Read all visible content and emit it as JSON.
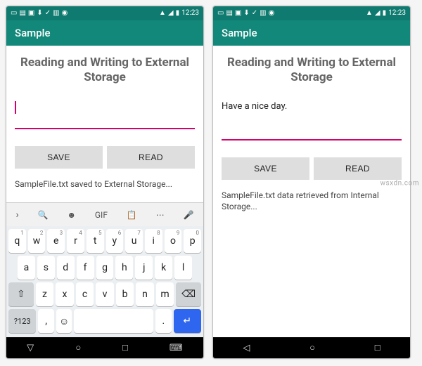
{
  "watermark": "wsxdn.com",
  "statusbar": {
    "time": "12:23"
  },
  "appbar": {
    "title": "Sample"
  },
  "screen": {
    "heading": "Reading and Writing to External Storage",
    "save_label": "SAVE",
    "read_label": "READ"
  },
  "left": {
    "input_value": "",
    "status_text": "SampleFile.txt saved to External Storage..."
  },
  "right": {
    "input_value": "Have a nice day.",
    "status_text": "SampleFile.txt data retrieved from Internal Storage..."
  },
  "keyboard": {
    "suggest": {
      "gif": "GIF"
    },
    "row1": [
      "q",
      "w",
      "e",
      "r",
      "t",
      "y",
      "u",
      "i",
      "o",
      "p"
    ],
    "nums1": [
      "1",
      "2",
      "3",
      "4",
      "5",
      "6",
      "7",
      "8",
      "9",
      "0"
    ],
    "row2": [
      "a",
      "s",
      "d",
      "f",
      "g",
      "h",
      "j",
      "k",
      "l"
    ],
    "row3": [
      "z",
      "x",
      "c",
      "v",
      "b",
      "n",
      "m"
    ],
    "shift": "⇧",
    "backspace": "⌫",
    "symbols": "?123",
    "comma": ",",
    "emoji": "☺",
    "period": ".",
    "enter": "↵"
  },
  "nav": {
    "back": "◁",
    "home": "○",
    "recent": "□",
    "kb": "⌨"
  }
}
